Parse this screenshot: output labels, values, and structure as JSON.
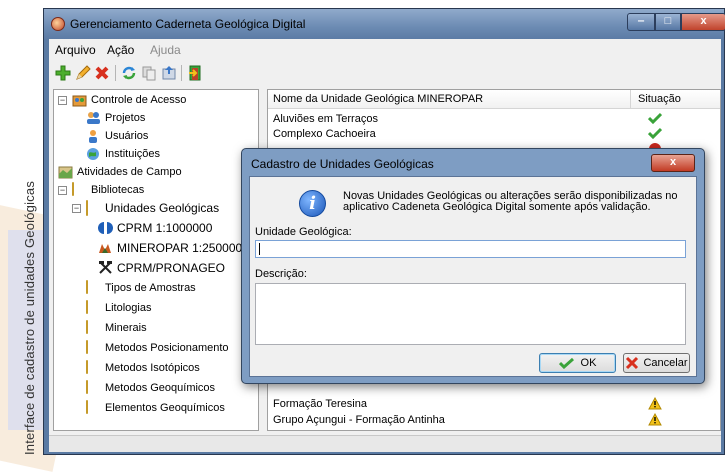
{
  "side_caption": "Interface de cadastro de unidades Geológicas",
  "window": {
    "title": "Gerenciamento Caderneta Geológica Digital",
    "buttons": {
      "minimize": "‒",
      "maximize": "□",
      "close": "x"
    }
  },
  "menu": {
    "arquivo": "Arquivo",
    "acao": "Ação",
    "ajuda": "Ajuda"
  },
  "tree": {
    "controle_acesso": "Controle de Acesso",
    "projetos": "Projetos",
    "usuarios": "Usuários",
    "instituicoes": "Instituições",
    "atividades_campo": "Atividades de Campo",
    "bibliotecas": "Bibliotecas",
    "unidades_geologicas": "Unidades Geológicas",
    "cprm": "CPRM 1:1000000",
    "mineropar": "MINEROPAR 1:250000",
    "cprm_pronageo": "CPRM/PRONAGEO",
    "tipos_amostras": "Tipos de Amostras",
    "litologias": "Litologias",
    "minerais": "Minerais",
    "metodos_posicionamento": "Metodos Posicionamento",
    "metodos_isotopicos": "Metodos Isotópicos",
    "metodos_geoquimicos": "Metodos Geoquímicos",
    "elementos_geoquimicos": "Elementos Geoquímicos"
  },
  "list": {
    "col_name": "Nome da Unidade Geológica MINEROPAR",
    "col_status": "Situação",
    "rows": [
      {
        "name": "Aluviões em Terraços",
        "status": "ok"
      },
      {
        "name": "Complexo Cachoeira",
        "status": "ok"
      },
      {
        "name": "Formação Teresina",
        "status": "warning"
      },
      {
        "name": "Grupo Açungui - Formação Antinha",
        "status": "warning"
      }
    ]
  },
  "dialog": {
    "title": "Cadastro de Unidades Geológicas",
    "close": "x",
    "info_line1": "Novas Unidades Geológicas ou alterações serão disponibilizadas no",
    "info_line2": "aplicativo Cadeneta Geológica Digital somente após validação.",
    "unidade_label": "Unidade Geológica:",
    "unidade_value": "",
    "descricao_label": "Descrição:",
    "descricao_value": "",
    "ok": "OK",
    "cancel": "Cancelar"
  },
  "colors": {
    "ok_green": "#3aa33a",
    "warning_yellow": "#f2c21b",
    "error_red": "#c8281e",
    "window_frame": "#5a7aa3"
  }
}
